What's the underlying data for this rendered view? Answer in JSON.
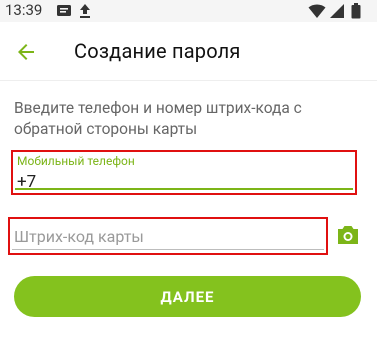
{
  "status_bar": {
    "time": "13:39",
    "icons": [
      "message-icon",
      "upload-icon",
      "wifi-icon",
      "signal-icon",
      "battery-icon"
    ]
  },
  "toolbar": {
    "back_icon": "arrow-left-icon",
    "title": "Создание пароля"
  },
  "form": {
    "instructions": "Введите телефон и номер штрих-кода с обратной стороны карты",
    "phone": {
      "label": "Мобильный телефон",
      "value": "+7"
    },
    "barcode": {
      "placeholder": "Штрих-код карты",
      "value": ""
    },
    "camera_icon": "camera-icon",
    "submit_label": "ДАЛЕЕ"
  },
  "colors": {
    "accent": "#84c21e",
    "label_green": "#7cb518",
    "highlight_red": "#e01010"
  }
}
